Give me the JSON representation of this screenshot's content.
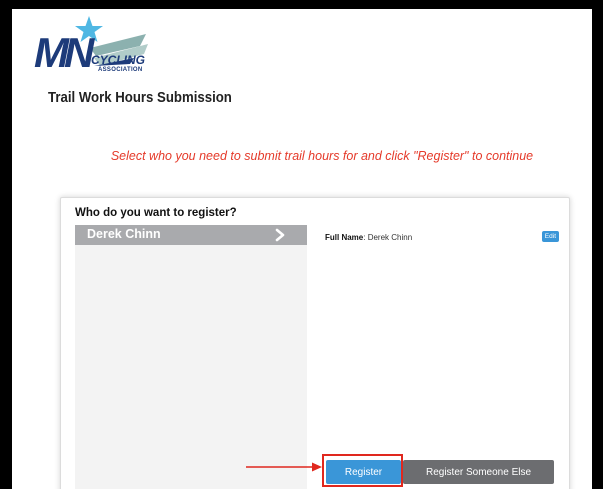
{
  "logo": {
    "letters": "MN",
    "word": "CYCLING",
    "subword": "ASSOCIATION",
    "colors": {
      "navy": "#1d3b7a",
      "star": "#4fb7e3",
      "wave": "#7fa8a6"
    }
  },
  "page": {
    "title": "Trail Work Hours Submission",
    "instruction": "Select who you need to submit trail hours for and click \"Register\" to continue"
  },
  "card": {
    "heading": "Who do you want to register?",
    "people": [
      {
        "name": "Derek Chinn",
        "icon": "chevron-right-icon"
      }
    ],
    "detail": {
      "label": "Full Name",
      "value": "Derek Chinn",
      "edit_label": "Edit"
    },
    "buttons": {
      "register": "Register",
      "register_other": "Register Someone Else"
    }
  },
  "colors": {
    "accent_blue": "#3a96d8",
    "instruction_red": "#e53a2a",
    "annotation_red": "#e0281e",
    "row_gray": "#a9aaad",
    "button_gray": "#6c6d70"
  }
}
